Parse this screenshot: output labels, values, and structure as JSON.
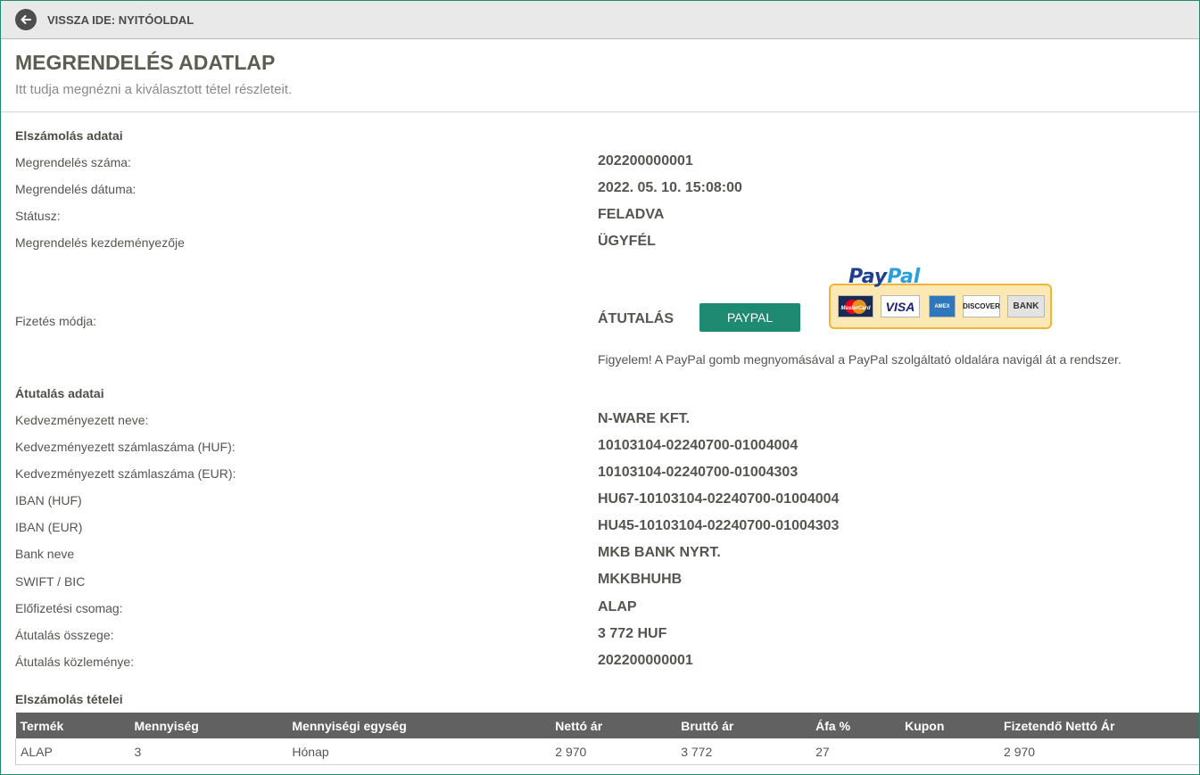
{
  "nav": {
    "back_label": "VISSZA IDE: NYITÓOLDAL"
  },
  "header": {
    "title": "MEGRENDELÉS ADATLAP",
    "subtitle": "Itt tudja megnézni a kiválasztott tétel részleteit."
  },
  "billing": {
    "section_title": "Elszámolás adatai",
    "rows": [
      {
        "label": "Megrendelés száma:",
        "value": "202200000001"
      },
      {
        "label": "Megrendelés dátuma:",
        "value": "2022. 05. 10. 15:08:00"
      },
      {
        "label": "Státusz:",
        "value": "FELADVA"
      },
      {
        "label": "Megrendelés kezdeményezője",
        "value": "ÜGYFÉL"
      }
    ]
  },
  "payment": {
    "label": "Fizetés módja:",
    "value": "ÁTUTALÁS",
    "paypal_button": "PAYPAL",
    "logo": {
      "word_a": "Pay",
      "word_b": "Pal",
      "cards": [
        "MasterCard",
        "VISA",
        "AMEX",
        "DISCOVER",
        "BANK"
      ]
    },
    "notice": "Figyelem! A PayPal gomb megnyomásával a PayPal szolgáltató oldalára navigál át a rendszer."
  },
  "transfer": {
    "section_title": "Átutalás adatai",
    "rows": [
      {
        "label": "Kedvezményezett neve:",
        "value": "N-WARE KFT."
      },
      {
        "label": "Kedvezményezett számlaszáma (HUF):",
        "value": "10103104-02240700-01004004"
      },
      {
        "label": "Kedvezményezett számlaszáma (EUR):",
        "value": "10103104-02240700-01004303"
      },
      {
        "label": "IBAN (HUF)",
        "value": "HU67-10103104-02240700-01004004"
      },
      {
        "label": "IBAN (EUR)",
        "value": "HU45-10103104-02240700-01004303"
      },
      {
        "label": "Bank neve",
        "value": "MKB BANK NYRT."
      },
      {
        "label": "SWIFT / BIC",
        "value": "MKKBHUHB"
      },
      {
        "label": "Előfizetési csomag:",
        "value": "ALAP"
      },
      {
        "label": "Átutalás összege:",
        "value": "3 772 HUF"
      },
      {
        "label": "Átutalás közleménye:",
        "value": "202200000001"
      }
    ]
  },
  "items": {
    "section_title": "Elszámolás tételei",
    "columns": [
      "Termék",
      "Mennyiség",
      "Mennyiségi egység",
      "Nettó ár",
      "Bruttó ár",
      "Áfa %",
      "Kupon",
      "Fizetendő Nettó Ár"
    ],
    "rows": [
      [
        "ALAP",
        "3",
        "Hónap",
        "2 970",
        "3 772",
        "27",
        "",
        "2 970"
      ]
    ]
  },
  "colors": {
    "accent": "#1e8a72",
    "table_header": "#616161",
    "text": "#55554f"
  }
}
